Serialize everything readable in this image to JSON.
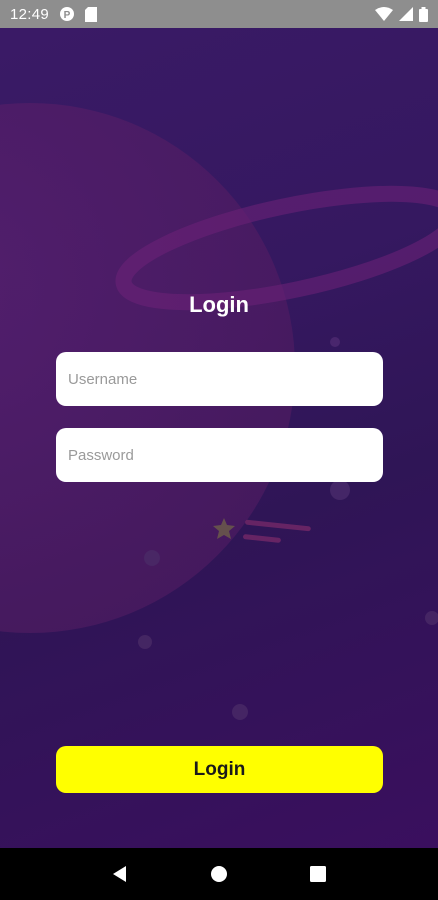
{
  "status_bar": {
    "time": "12:49",
    "left_icons": [
      "p-circle-icon",
      "sd-card-icon"
    ],
    "right_icons": [
      "wifi-icon",
      "signal-icon",
      "battery-icon"
    ]
  },
  "login": {
    "title": "Login",
    "username_placeholder": "Username",
    "password_placeholder": "Password",
    "button_label": "Login"
  },
  "nav_bar": {
    "buttons": [
      "back-icon",
      "home-icon",
      "recents-icon"
    ]
  },
  "colors": {
    "background": "#351860",
    "button": "#ffff00",
    "status_bar": "#8e8e8e"
  }
}
